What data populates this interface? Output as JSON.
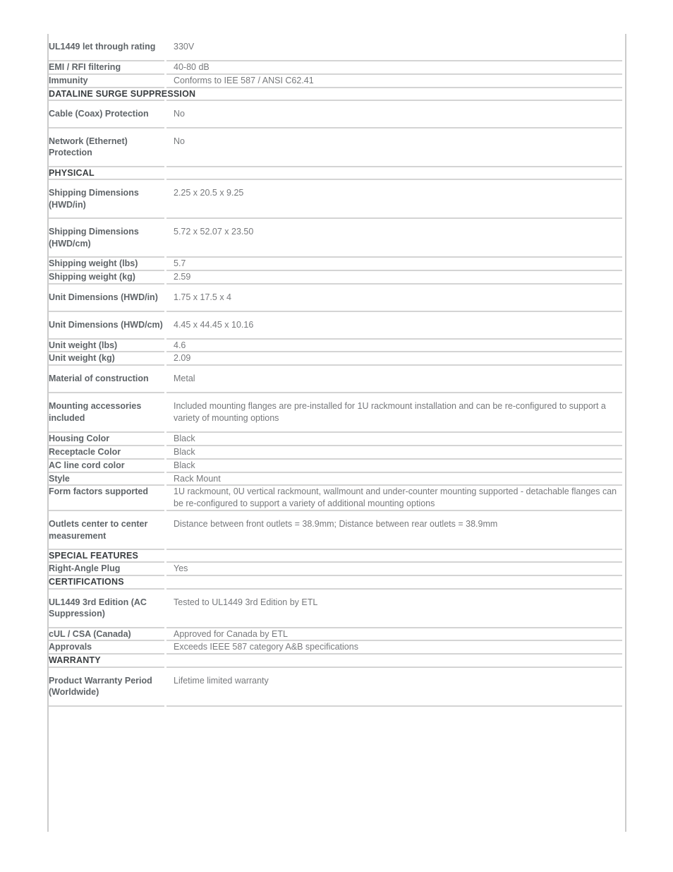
{
  "spec_sheet": {
    "colors": {
      "rule": "#d4d4d4",
      "label_text": "#5f6468",
      "value_text": "#77797c",
      "section_text": "#3b3f42",
      "background": "#ffffff"
    },
    "rows": [
      {
        "type": "spec",
        "label": "UL1449 let through rating",
        "value": "330V"
      },
      {
        "type": "spec",
        "label": "EMI / RFI filtering",
        "value": "40-80 dB"
      },
      {
        "type": "spec",
        "label": "Immunity",
        "value": "Conforms to IEE 587 / ANSI C62.41"
      },
      {
        "type": "section",
        "label": "DATALINE SURGE SUPPRESSION"
      },
      {
        "type": "spec",
        "label": "Cable (Coax) Protection",
        "value": "No"
      },
      {
        "type": "spec",
        "label": "Network (Ethernet) Protection",
        "value": "No"
      },
      {
        "type": "section",
        "label": "PHYSICAL"
      },
      {
        "type": "spec",
        "label": "Shipping Dimensions (HWD/in)",
        "value": "2.25 x 20.5 x 9.25"
      },
      {
        "type": "spec",
        "label": "Shipping Dimensions (HWD/cm)",
        "value": "5.72 x 52.07 x 23.50"
      },
      {
        "type": "spec",
        "label": "Shipping weight (lbs)",
        "value": "5.7"
      },
      {
        "type": "spec",
        "label": "Shipping weight (kg)",
        "value": "2.59"
      },
      {
        "type": "spec",
        "label": "Unit Dimensions (HWD/in)",
        "value": "1.75 x 17.5 x 4"
      },
      {
        "type": "spec",
        "label": "Unit Dimensions (HWD/cm)",
        "value": "4.45 x 44.45 x 10.16"
      },
      {
        "type": "spec",
        "label": "Unit weight (lbs)",
        "value": "4.6"
      },
      {
        "type": "spec",
        "label": "Unit weight (kg)",
        "value": "2.09"
      },
      {
        "type": "spec",
        "label": "Material of construction",
        "value": "Metal"
      },
      {
        "type": "spec",
        "label": "Mounting accessories included",
        "value": "Included mounting flanges are pre-installed for 1U rackmount installation and can be re-configured to support a variety of mounting options"
      },
      {
        "type": "spec",
        "label": "Housing Color",
        "value": "Black"
      },
      {
        "type": "spec",
        "label": "Receptacle Color",
        "value": "Black"
      },
      {
        "type": "spec",
        "label": "AC line cord color",
        "value": "Black"
      },
      {
        "type": "spec",
        "label": "Style",
        "value": "Rack Mount"
      },
      {
        "type": "spec",
        "label": "Form factors supported",
        "value": "1U rackmount, 0U vertical rackmount, wallmount and under-counter mounting supported - detachable flanges can be re-configured to support a variety of additional mounting options"
      },
      {
        "type": "spec",
        "label": "Outlets center to center measurement",
        "value": "Distance between front outlets = 38.9mm; Distance between rear outlets = 38.9mm"
      },
      {
        "type": "section",
        "label": "SPECIAL FEATURES"
      },
      {
        "type": "spec",
        "label": "Right-Angle Plug",
        "value": "Yes"
      },
      {
        "type": "section",
        "label": "CERTIFICATIONS"
      },
      {
        "type": "spec",
        "label": "UL1449 3rd Edition (AC Suppression)",
        "value": "Tested to UL1449 3rd Edition by ETL"
      },
      {
        "type": "spec",
        "label": "cUL / CSA (Canada)",
        "value": "Approved for Canada by ETL"
      },
      {
        "type": "spec",
        "label": "Approvals",
        "value": "Exceeds IEEE 587 category A&B specifications"
      },
      {
        "type": "section",
        "label": "WARRANTY"
      },
      {
        "type": "spec",
        "label": "Product Warranty Period (Worldwide)",
        "value": "Lifetime limited warranty"
      }
    ]
  }
}
